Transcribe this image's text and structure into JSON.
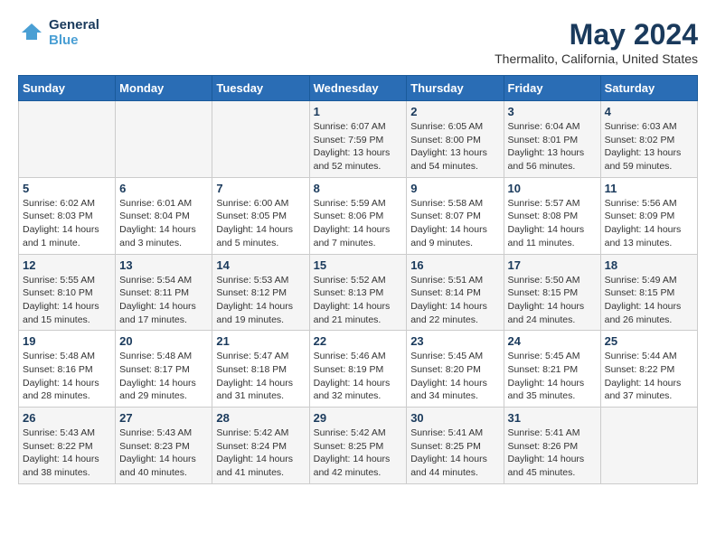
{
  "header": {
    "logo_line1": "General",
    "logo_line2": "Blue",
    "main_title": "May 2024",
    "subtitle": "Thermalito, California, United States"
  },
  "days_of_week": [
    "Sunday",
    "Monday",
    "Tuesday",
    "Wednesday",
    "Thursday",
    "Friday",
    "Saturday"
  ],
  "weeks": [
    [
      {
        "day": "",
        "info": ""
      },
      {
        "day": "",
        "info": ""
      },
      {
        "day": "",
        "info": ""
      },
      {
        "day": "1",
        "info": "Sunrise: 6:07 AM\nSunset: 7:59 PM\nDaylight: 13 hours\nand 52 minutes."
      },
      {
        "day": "2",
        "info": "Sunrise: 6:05 AM\nSunset: 8:00 PM\nDaylight: 13 hours\nand 54 minutes."
      },
      {
        "day": "3",
        "info": "Sunrise: 6:04 AM\nSunset: 8:01 PM\nDaylight: 13 hours\nand 56 minutes."
      },
      {
        "day": "4",
        "info": "Sunrise: 6:03 AM\nSunset: 8:02 PM\nDaylight: 13 hours\nand 59 minutes."
      }
    ],
    [
      {
        "day": "5",
        "info": "Sunrise: 6:02 AM\nSunset: 8:03 PM\nDaylight: 14 hours\nand 1 minute."
      },
      {
        "day": "6",
        "info": "Sunrise: 6:01 AM\nSunset: 8:04 PM\nDaylight: 14 hours\nand 3 minutes."
      },
      {
        "day": "7",
        "info": "Sunrise: 6:00 AM\nSunset: 8:05 PM\nDaylight: 14 hours\nand 5 minutes."
      },
      {
        "day": "8",
        "info": "Sunrise: 5:59 AM\nSunset: 8:06 PM\nDaylight: 14 hours\nand 7 minutes."
      },
      {
        "day": "9",
        "info": "Sunrise: 5:58 AM\nSunset: 8:07 PM\nDaylight: 14 hours\nand 9 minutes."
      },
      {
        "day": "10",
        "info": "Sunrise: 5:57 AM\nSunset: 8:08 PM\nDaylight: 14 hours\nand 11 minutes."
      },
      {
        "day": "11",
        "info": "Sunrise: 5:56 AM\nSunset: 8:09 PM\nDaylight: 14 hours\nand 13 minutes."
      }
    ],
    [
      {
        "day": "12",
        "info": "Sunrise: 5:55 AM\nSunset: 8:10 PM\nDaylight: 14 hours\nand 15 minutes."
      },
      {
        "day": "13",
        "info": "Sunrise: 5:54 AM\nSunset: 8:11 PM\nDaylight: 14 hours\nand 17 minutes."
      },
      {
        "day": "14",
        "info": "Sunrise: 5:53 AM\nSunset: 8:12 PM\nDaylight: 14 hours\nand 19 minutes."
      },
      {
        "day": "15",
        "info": "Sunrise: 5:52 AM\nSunset: 8:13 PM\nDaylight: 14 hours\nand 21 minutes."
      },
      {
        "day": "16",
        "info": "Sunrise: 5:51 AM\nSunset: 8:14 PM\nDaylight: 14 hours\nand 22 minutes."
      },
      {
        "day": "17",
        "info": "Sunrise: 5:50 AM\nSunset: 8:15 PM\nDaylight: 14 hours\nand 24 minutes."
      },
      {
        "day": "18",
        "info": "Sunrise: 5:49 AM\nSunset: 8:15 PM\nDaylight: 14 hours\nand 26 minutes."
      }
    ],
    [
      {
        "day": "19",
        "info": "Sunrise: 5:48 AM\nSunset: 8:16 PM\nDaylight: 14 hours\nand 28 minutes."
      },
      {
        "day": "20",
        "info": "Sunrise: 5:48 AM\nSunset: 8:17 PM\nDaylight: 14 hours\nand 29 minutes."
      },
      {
        "day": "21",
        "info": "Sunrise: 5:47 AM\nSunset: 8:18 PM\nDaylight: 14 hours\nand 31 minutes."
      },
      {
        "day": "22",
        "info": "Sunrise: 5:46 AM\nSunset: 8:19 PM\nDaylight: 14 hours\nand 32 minutes."
      },
      {
        "day": "23",
        "info": "Sunrise: 5:45 AM\nSunset: 8:20 PM\nDaylight: 14 hours\nand 34 minutes."
      },
      {
        "day": "24",
        "info": "Sunrise: 5:45 AM\nSunset: 8:21 PM\nDaylight: 14 hours\nand 35 minutes."
      },
      {
        "day": "25",
        "info": "Sunrise: 5:44 AM\nSunset: 8:22 PM\nDaylight: 14 hours\nand 37 minutes."
      }
    ],
    [
      {
        "day": "26",
        "info": "Sunrise: 5:43 AM\nSunset: 8:22 PM\nDaylight: 14 hours\nand 38 minutes."
      },
      {
        "day": "27",
        "info": "Sunrise: 5:43 AM\nSunset: 8:23 PM\nDaylight: 14 hours\nand 40 minutes."
      },
      {
        "day": "28",
        "info": "Sunrise: 5:42 AM\nSunset: 8:24 PM\nDaylight: 14 hours\nand 41 minutes."
      },
      {
        "day": "29",
        "info": "Sunrise: 5:42 AM\nSunset: 8:25 PM\nDaylight: 14 hours\nand 42 minutes."
      },
      {
        "day": "30",
        "info": "Sunrise: 5:41 AM\nSunset: 8:25 PM\nDaylight: 14 hours\nand 44 minutes."
      },
      {
        "day": "31",
        "info": "Sunrise: 5:41 AM\nSunset: 8:26 PM\nDaylight: 14 hours\nand 45 minutes."
      },
      {
        "day": "",
        "info": ""
      }
    ]
  ]
}
